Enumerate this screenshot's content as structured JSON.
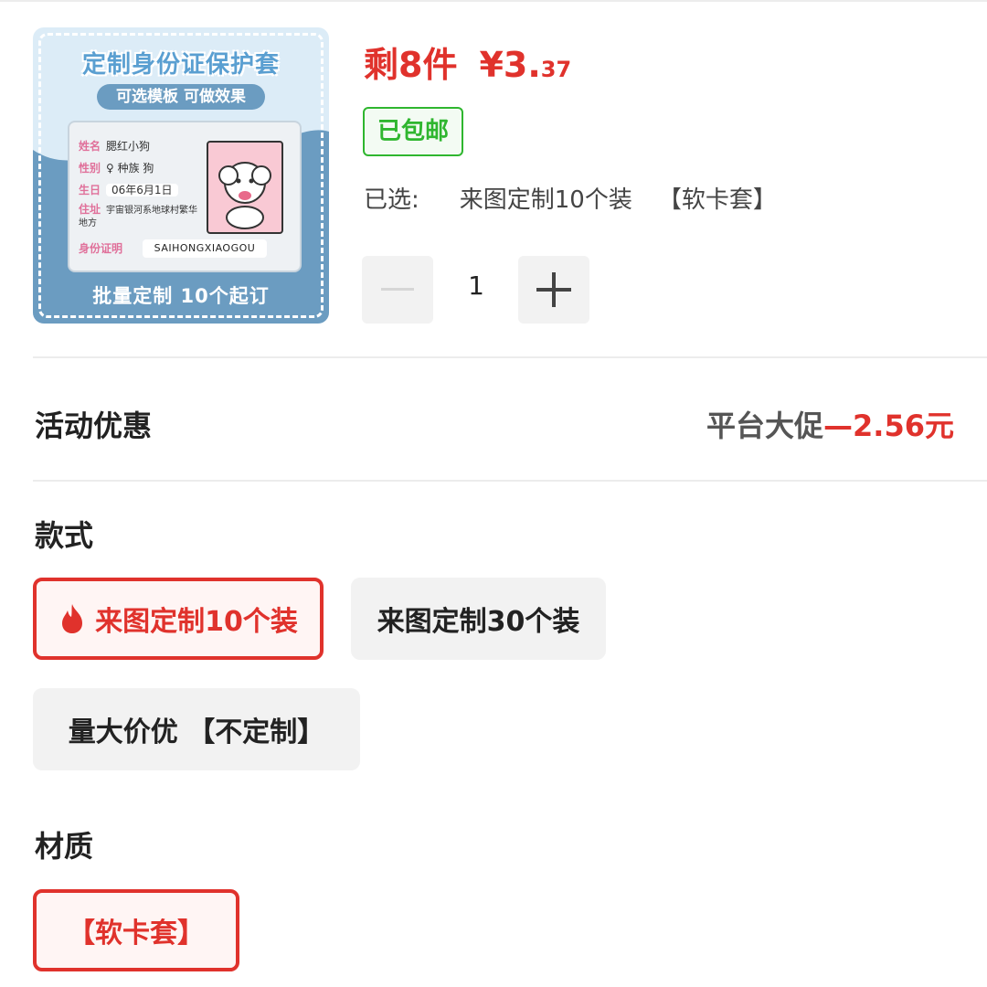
{
  "product_image": {
    "title": "定制身份证保护套",
    "subtitle": "可选模板 可做效果",
    "card": {
      "rows": [
        {
          "key": "姓名",
          "value": "腮红小狗"
        },
        {
          "key": "性别",
          "value": "♀ 种族 狗"
        },
        {
          "key": "生日",
          "value": "06年6月1日"
        },
        {
          "key": "住址",
          "value": "宇宙银河系地球村繁华地方"
        }
      ],
      "id_key": "身份证明",
      "id_value": "SAIHONGXIAOGOU"
    },
    "bottom_text": "批量定制 10个起订"
  },
  "price": {
    "remaining": "剩8件",
    "currency": "¥",
    "integer": "3.",
    "decimal": "37",
    "color": "#e0322c"
  },
  "shipping_badge": "已包邮",
  "selected": {
    "label": "已选:",
    "style_value": "来图定制10个装",
    "material_value": "【软卡套】"
  },
  "quantity": {
    "value": "1"
  },
  "promotion": {
    "label": "活动优惠",
    "desc": "平台大促",
    "amount": "—2.56元"
  },
  "style_section": {
    "label": "款式",
    "options": [
      {
        "label": "来图定制10个装",
        "selected": true,
        "icon": "fire-icon"
      },
      {
        "label": "来图定制30个装",
        "selected": false
      },
      {
        "label": "量大价优 【不定制】",
        "selected": false
      }
    ]
  },
  "material_section": {
    "label": "材质",
    "options": [
      {
        "label": "【软卡套】",
        "selected": true
      }
    ]
  },
  "colors": {
    "accent_red": "#e0322c",
    "badge_green": "#2fb62f",
    "chip_gray": "#f2f2f2"
  }
}
